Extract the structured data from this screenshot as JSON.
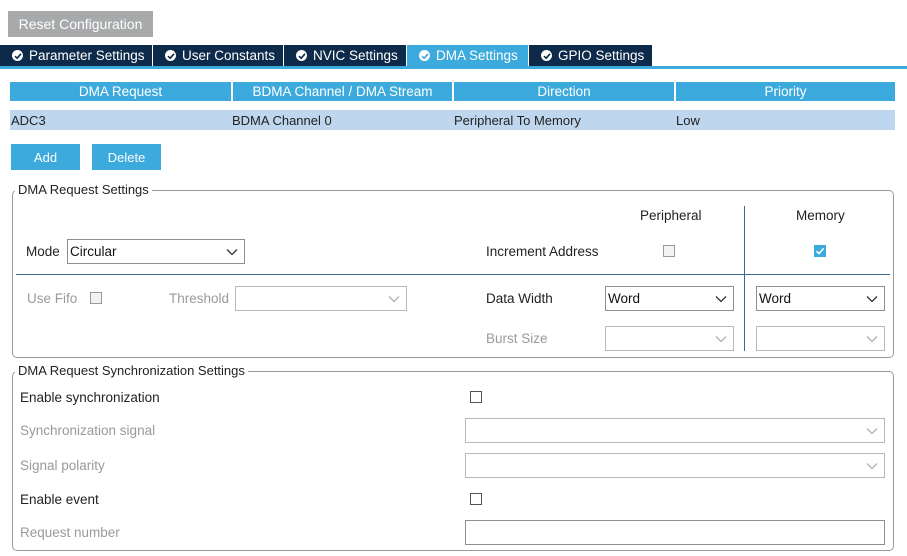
{
  "toolbar": {
    "reset_label": "Reset Configuration"
  },
  "tabs": [
    {
      "label": "Parameter Settings",
      "active": false
    },
    {
      "label": "User Constants",
      "active": false
    },
    {
      "label": "NVIC Settings",
      "active": false
    },
    {
      "label": "DMA Settings",
      "active": true
    },
    {
      "label": "GPIO Settings",
      "active": false
    }
  ],
  "dma_table": {
    "headers": [
      "DMA Request",
      "BDMA Channel / DMA Stream",
      "Direction",
      "Priority"
    ],
    "rows": [
      [
        "ADC3",
        "BDMA Channel 0",
        "Peripheral To Memory",
        "Low"
      ]
    ]
  },
  "buttons": {
    "add": "Add",
    "delete": "Delete"
  },
  "request_settings": {
    "legend": "DMA Request Settings",
    "peripheral_header": "Peripheral",
    "memory_header": "Memory",
    "mode_label": "Mode",
    "mode_value": "Circular",
    "increment_address_label": "Increment Address",
    "increment_peripheral_checked": false,
    "increment_memory_checked": true,
    "use_fifo_label": "Use Fifo",
    "threshold_label": "Threshold",
    "threshold_value": "",
    "data_width_label": "Data Width",
    "data_width_peripheral": "Word",
    "data_width_memory": "Word",
    "burst_size_label": "Burst Size",
    "burst_peripheral": "",
    "burst_memory": ""
  },
  "sync_settings": {
    "legend": "DMA Request Synchronization Settings",
    "enable_sync_label": "Enable synchronization",
    "sync_signal_label": "Synchronization signal",
    "signal_polarity_label": "Signal polarity",
    "enable_event_label": "Enable event",
    "request_number_label": "Request number",
    "sync_signal_value": "",
    "signal_polarity_value": "",
    "request_number_value": ""
  },
  "colors": {
    "accent": "#3caadd",
    "tab_dark": "#0d2a4a",
    "row_selected": "#bfd7ee",
    "reset_button": "#a7a9ab"
  }
}
